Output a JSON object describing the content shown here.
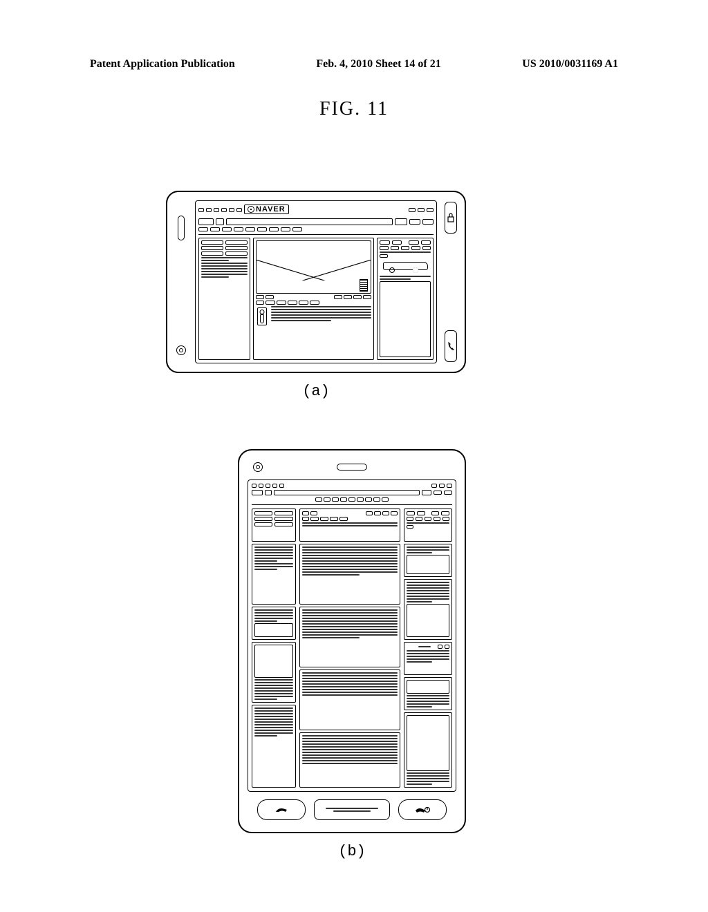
{
  "header": {
    "left": "Patent Application Publication",
    "center": "Feb. 4, 2010   Sheet 14 of 21",
    "right": "US 2010/0031169 A1"
  },
  "figure_label": "FIG.  11",
  "sub_a": "(a)",
  "sub_b": "(b)",
  "brand": "NAVER"
}
